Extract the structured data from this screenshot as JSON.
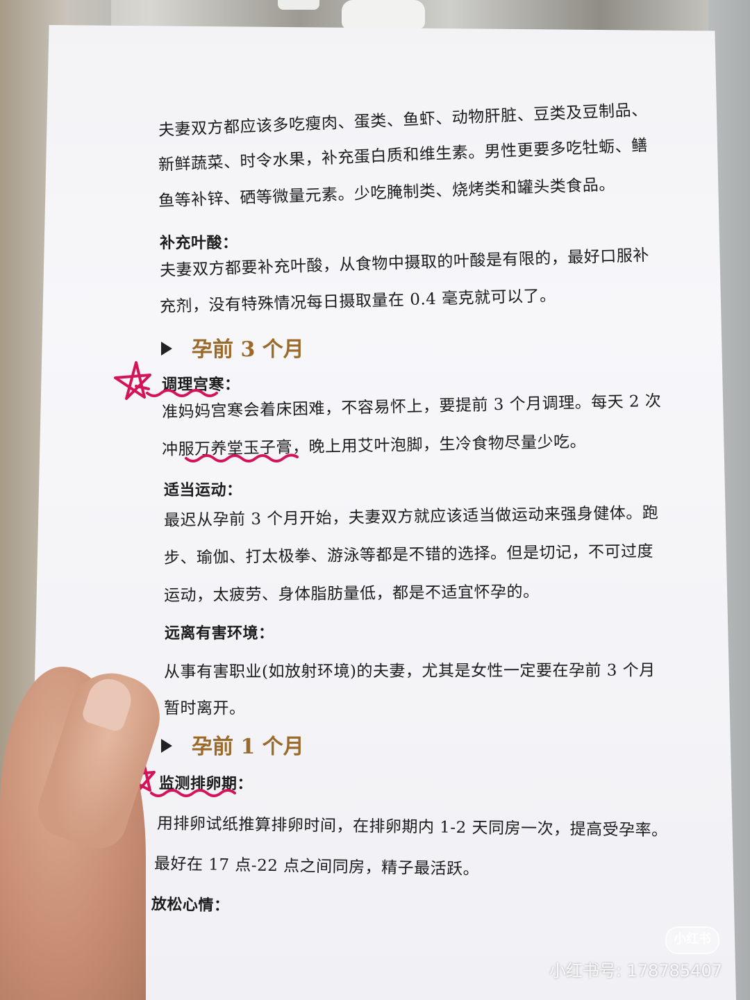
{
  "document": {
    "diet_lines": [
      "夫妻双方都应该多吃瘦肉、蛋类、鱼虾、动物肝脏、豆类及豆制品、",
      "新鲜蔬菜、时令水果，补充蛋白质和维生素。男性更要多吃牡蛎、鳝",
      "鱼等补锌、硒等微量元素。少吃腌制类、烧烤类和罐头类食品。"
    ],
    "folic": {
      "title": "补充叶酸：",
      "lines": [
        "夫妻双方都要补充叶酸，从食物中摄取的叶酸是有限的，最好口服补",
        "充剂，没有特殊情况每日摄取量在 0.4 毫克就可以了。"
      ]
    },
    "heading_3m": "孕前 3 个月",
    "cold": {
      "title": "调理宫寒：",
      "line1": "准妈妈宫寒会着床困难，不容易怀上，要提前 3 个月调理。每天 2 次",
      "line2_pre": "冲服",
      "line2_product": "万养堂玉子膏",
      "line2_post": "，晚上用艾叶泡脚，生冷食物尽量少吃。"
    },
    "exercise": {
      "title": "适当运动：",
      "lines": [
        "最迟从孕前 3 个月开始，夫妻双方就应该适当做运动来强身健体。跑",
        "步、瑜伽、打太极拳、游泳等都是不错的选择。但是切记，不可过度",
        "运动，太疲劳、身体脂肪量低，都是不适宜怀孕的。"
      ]
    },
    "env": {
      "title": "远离有害环境：",
      "lines": [
        "从事有害职业(如放射环境)的夫妻，尤其是女性一定要在孕前 3 个月",
        "暂时离开。"
      ]
    },
    "heading_1m": "孕前 1 个月",
    "ovulation": {
      "title": "监测排卵期：",
      "lines": [
        "用排卵试纸推算排卵时间，在排卵期内 1-2 天同房一次，提高受孕率。",
        "最好在 17 点-22 点之间同房，精子最活跃。"
      ]
    },
    "relax": {
      "title": "放松心情："
    }
  },
  "watermark": {
    "logo": "小红书",
    "id_text": "小红书号: 178785407"
  },
  "colors": {
    "heading": "#9a6a2a",
    "annotation": "#d4145a"
  }
}
